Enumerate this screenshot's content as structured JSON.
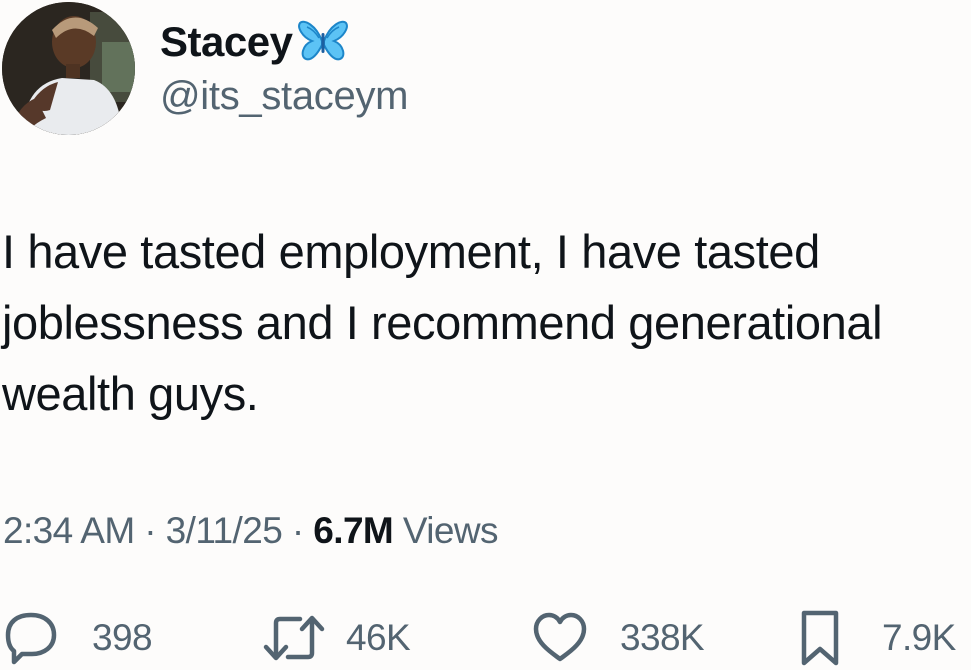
{
  "author": {
    "display_name": "Stacey",
    "handle": "@its_staceym",
    "avatar_icon": "profile-photo",
    "badge_icon": "butterfly-emoji",
    "badge_color": "#1d9bf0"
  },
  "tweet": {
    "text": "I have tasted employment, I have tasted\njoblessness and I recommend generational\nwealth guys."
  },
  "meta": {
    "time": "2:34 AM",
    "separator": "·",
    "date": "3/11/25",
    "views_count": "6.7M",
    "views_label": "Views"
  },
  "actions": {
    "reply": {
      "icon": "reply-icon",
      "count": "398"
    },
    "retweet": {
      "icon": "retweet-icon",
      "count": "46K"
    },
    "like": {
      "icon": "heart-icon",
      "count": "338K"
    },
    "bookmark": {
      "icon": "bookmark-icon",
      "count": "7.9K"
    }
  },
  "colors": {
    "text_primary": "#0f1419",
    "text_secondary": "#536471",
    "background": "#fdfcfb"
  }
}
